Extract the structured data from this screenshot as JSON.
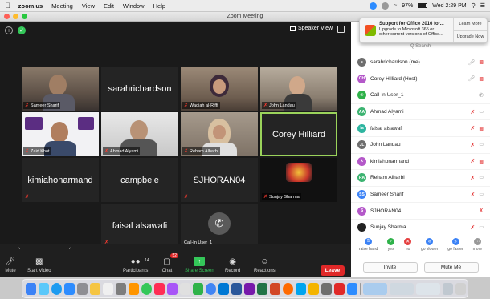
{
  "menubar": {
    "app": "zoom.us",
    "items": [
      "Meeting",
      "View",
      "Edit",
      "Window",
      "Help"
    ],
    "battery": "97%",
    "clock": "Wed 2:29 PM"
  },
  "window": {
    "title": "Zoom Meeting"
  },
  "view": {
    "speaker_view_label": "Speaker View"
  },
  "tiles": [
    {
      "name": "Sameer Sharif",
      "label": "Sameer Sharif",
      "type": "video",
      "color": "#7a6a5c"
    },
    {
      "name": "sarahrichardson",
      "label": "",
      "type": "name"
    },
    {
      "name": "Wadiah al-Riffi",
      "label": "Wadiah al-Riffi",
      "type": "video",
      "color": "#8c7a6a"
    },
    {
      "name": "John Landau",
      "label": "John Landau",
      "type": "video",
      "color": "#9a8e80"
    },
    {
      "name": "Zaid Khot",
      "label": "Zaid Khot",
      "type": "video",
      "color": "#b8b6c2"
    },
    {
      "name": "Ahmad Alyami",
      "label": "Ahmad Alyami",
      "type": "video",
      "color": "#7a7a7a"
    },
    {
      "name": "Reham Alharbi",
      "label": "Reham Alharbi",
      "type": "video",
      "color": "#8a8074"
    },
    {
      "name": "Corey Hilliard",
      "label": "",
      "type": "name",
      "active": true
    },
    {
      "name": "kimiahonarmand",
      "label": "",
      "type": "name"
    },
    {
      "name": "campbele",
      "label": "",
      "type": "name"
    },
    {
      "name": "SJHORAN04",
      "label": "",
      "type": "name"
    },
    {
      "name": "Sunjay Sharma",
      "label": "Sunjay Sharma",
      "type": "vegas"
    },
    {
      "name": "faisal alsawafi",
      "label": "",
      "type": "name"
    },
    {
      "name": "Call-In User_1",
      "label": "Call-In User_1",
      "type": "phone"
    }
  ],
  "toolbar": {
    "mute": "Mute",
    "start_video": "Start Video",
    "participants": "Participants",
    "participants_count": "14",
    "chat": "Chat",
    "chat_badge": "52",
    "share_screen": "Share Screen",
    "record": "Record",
    "reactions": "Reactions",
    "leave": "Leave"
  },
  "notification": {
    "title": "Support for Office 2016 for...",
    "line2": "Upgrade to Microsoft 365 or",
    "line3": "other current versions of Office...",
    "learn_more": "Learn More",
    "upgrade_now": "Upgrade Now"
  },
  "panel": {
    "search_placeholder": "Q Search",
    "participants": [
      {
        "initials": "s",
        "name": "sarahrichardson (me)",
        "color": "#6e6e6e",
        "mic": "on",
        "cam": "off"
      },
      {
        "initials": "CH",
        "name": "Corey Hilliard (Host)",
        "color": "#b458c9",
        "mic": "on",
        "cam": "off"
      },
      {
        "initials": "",
        "name": "Call-In User_1",
        "color": "#2fb24a",
        "mic": "phone",
        "cam": ""
      },
      {
        "initials": "AA",
        "name": "Ahmad Alyami",
        "color": "#3cb371",
        "mic": "off",
        "cam": "on"
      },
      {
        "initials": "fa",
        "name": "faisal alsawafi",
        "color": "#2eb5a0",
        "mic": "off",
        "cam": "off"
      },
      {
        "initials": "JL",
        "name": "John Landau",
        "color": "#6e6e6e",
        "mic": "off",
        "cam": "on"
      },
      {
        "initials": "k",
        "name": "kimiahonarmand",
        "color": "#b458c9",
        "mic": "off",
        "cam": "off"
      },
      {
        "initials": "RA",
        "name": "Reham Alharbi",
        "color": "#3cb371",
        "mic": "off",
        "cam": "on"
      },
      {
        "initials": "SS",
        "name": "Sameer Sharif",
        "color": "#3b82f6",
        "mic": "off",
        "cam": "on"
      },
      {
        "initials": "S",
        "name": "SJHORAN04",
        "color": "#b458c9",
        "mic": "off",
        "cam": ""
      },
      {
        "initials": "",
        "name": "Sunjay Sharma",
        "color": "#222222",
        "mic": "off",
        "cam": "on"
      }
    ],
    "reactions": [
      {
        "label": "raise hand",
        "color": "#3b82f6"
      },
      {
        "label": "yes",
        "color": "#2fb24a"
      },
      {
        "label": "no",
        "color": "#e54040"
      },
      {
        "label": "go slower",
        "color": "#3b82f6"
      },
      {
        "label": "go faster",
        "color": "#3b82f6"
      },
      {
        "label": "more",
        "color": "#999999"
      }
    ],
    "invite": "Invite",
    "mute_me": "Mute Me"
  },
  "colors": {
    "accent": "#9bd35b",
    "leave": "#e02828",
    "share": "#34c759"
  }
}
